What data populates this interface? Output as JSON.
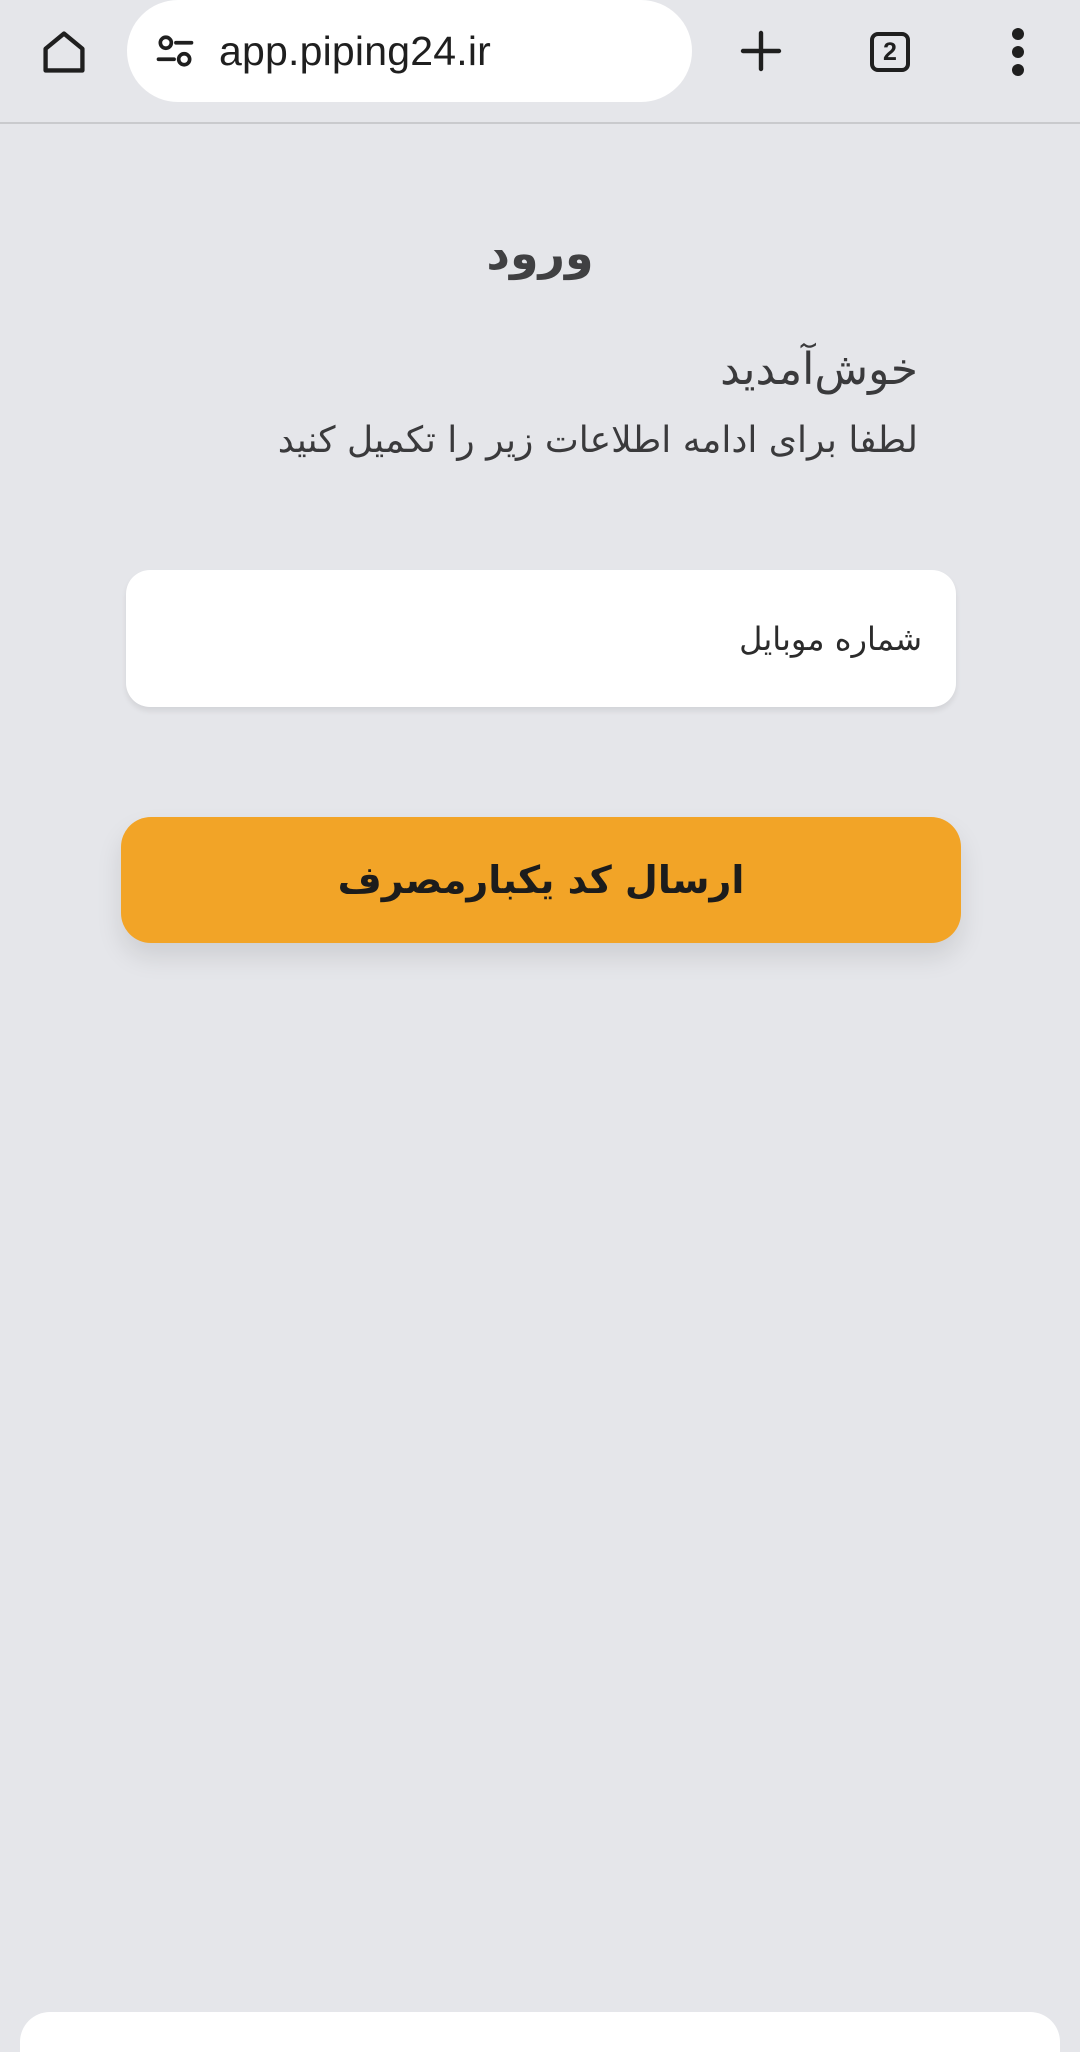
{
  "browser": {
    "url": "app.piping24.ir",
    "tab_count": "2",
    "icons": {
      "home": "home-icon",
      "site_settings": "tune-icon",
      "new_tab": "plus-icon",
      "tabs": "tab-switcher-icon",
      "menu": "more-vert-icon"
    }
  },
  "login": {
    "title": "ورود",
    "welcome_title": "خوش‌آمدید",
    "welcome_subtitle": "لطفا برای ادامه اطلاعات زیر را تکمیل کنید",
    "mobile_placeholder": "شماره موبایل",
    "mobile_value": "",
    "submit_label": "ارسال کد یکبارمصرف"
  },
  "colors": {
    "background": "#e5e6ea",
    "accent": "#f2a427",
    "field_bg": "#ffffff",
    "text": "#3a3a3c"
  }
}
